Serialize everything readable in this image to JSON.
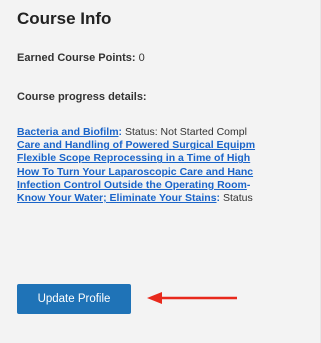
{
  "panel": {
    "title": "Course Info",
    "earned_points_label": "Earned Course Points:",
    "earned_points_value": "0",
    "progress_heading": "Course progress details:"
  },
  "courses": [
    {
      "title": "Bacteria and Biofilm",
      "sep": ":",
      "status": " Status: Not Started Compl"
    },
    {
      "title": "Care and Handling of Powered Surgical Equipm",
      "sep": "",
      "status": ""
    },
    {
      "title": "Flexible Scope Reprocessing in a Time of High",
      "sep": "",
      "status": ""
    },
    {
      "title": "How To Turn Your Laparoscopic Care and Hanc",
      "sep": "",
      "status": ""
    },
    {
      "title": "Infection Control Outside the Operating Room",
      "sep": "-",
      "status": ""
    },
    {
      "title": "Know Your Water; Eliminate Your Stains",
      "sep": ":",
      "status": " Status"
    }
  ],
  "actions": {
    "update_profile_label": "Update Profile"
  },
  "colors": {
    "link": "#1a64c9",
    "button": "#1f73b7",
    "annotation_arrow": "#e8291c"
  }
}
